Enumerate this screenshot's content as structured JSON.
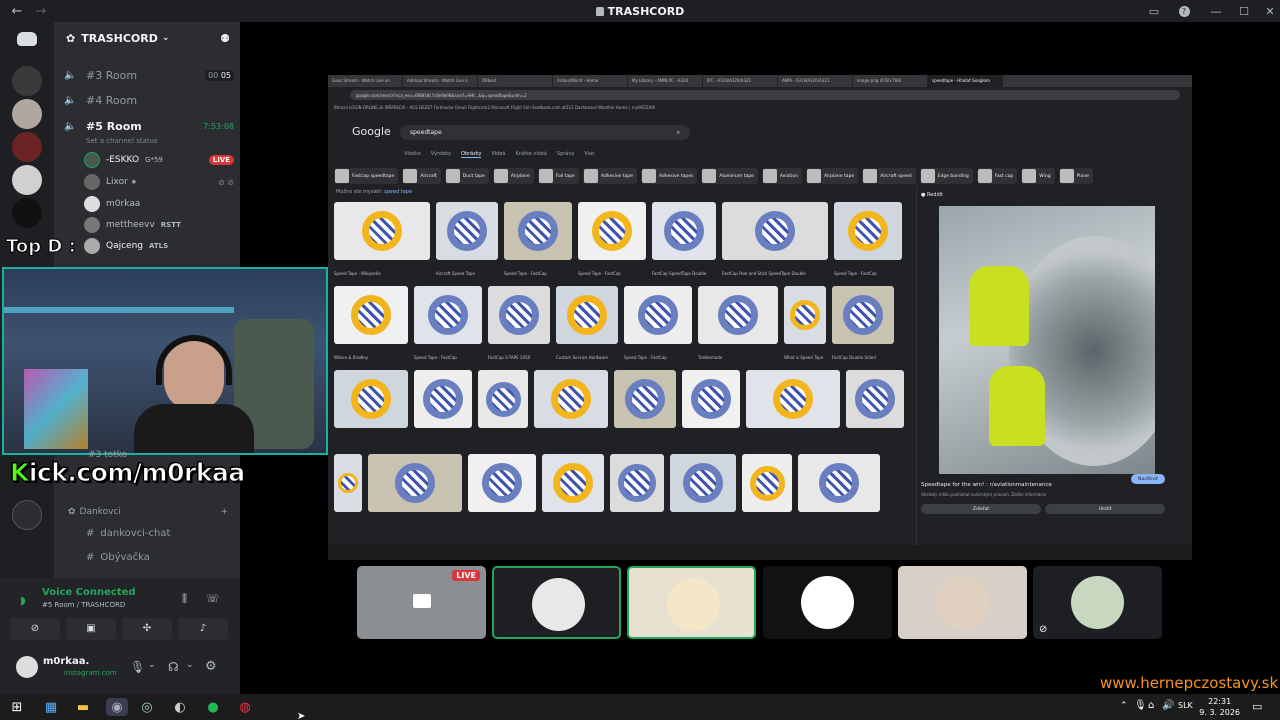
{
  "window": {
    "title": "TRASHCORD"
  },
  "server": {
    "name": "TRASHCORD",
    "voice_channels": [
      {
        "name": "#3 Room",
        "counter_a": "00",
        "counter_b": "05",
        "active": false
      },
      {
        "name": "#4 Room",
        "active": false
      },
      {
        "name": "#5 Room",
        "timer": "7:53:08",
        "active": true,
        "status": "Set a channel status"
      }
    ],
    "members": [
      {
        "name": "-ESKKO",
        "tag": "G*59",
        "live": "LIVE"
      },
      {
        "name": "Lixor",
        "tag": "★"
      },
      {
        "name": "m0rkaa"
      },
      {
        "name": "mettheevv",
        "tag": "RSTT"
      },
      {
        "name": "Qajceng",
        "tag": "ATLS"
      }
    ],
    "category": "Dankovci",
    "text_channels": [
      "dankovci-chat",
      "Obývačka"
    ]
  },
  "voice": {
    "status": "Voice Connected",
    "location": "#5 Room / TRASHCORD"
  },
  "user": {
    "name": "m0rkaa.",
    "subtitle": "instagram.com"
  },
  "overlay": {
    "kick_prefix": "K",
    "kick_rest": "ick.com/m0rkaa",
    "top_label": "Top D :",
    "hidden_channel_fragment": "#3 totko"
  },
  "stream": {
    "browser_tabs": [
      "Gaas Stream - Watch Live on",
      "m0rkaa Stream - Watch Live o",
      "OKbest",
      "Airbus/World - Home",
      "My Library - AMNLPC - A320",
      "IPC - A319/A320/A321",
      "AMM - A319/A320/A321",
      "image.png (678×768)",
      "speedtape - Hľadať Googlom"
    ],
    "url": "google.com/search?sca_esv=6f8818c7c8e9b98&sxsrf=AHt...&q=speedtape&udm=2",
    "bookmarks": "Bhmail  LOGIN ORLINE.sk  INŠPEKCIA - AGS  DEZET  Forkhome  Gmail  Flightcom2  Microsoft Flight Sim  Seatbook.com  atZ11 Dashboard  Weather  Home | myWIZZAIR",
    "search_query": "speedtape",
    "google_tabs": [
      "Všetko",
      "Výrobky",
      "Obrázky",
      "Videá",
      "Krátke videá",
      "Správy",
      "Viac"
    ],
    "active_google_tab": "Obrázky",
    "chips": [
      "Fastcap speedtape",
      "Aircraft",
      "Duct tape",
      "Airplane",
      "Foil tape",
      "Adhesive tape",
      "Adhesive tapes",
      "Aluminum tape",
      "Aviation",
      "Airplane tape",
      "Aircraft speed",
      "Edge banding",
      "Fast cap",
      "Wing",
      "Plane"
    ],
    "related_prefix": "Možno ste mysleli:",
    "related_term": "speed tape",
    "captions": [
      "Speed Tape - Wikipedia",
      "Aircraft Speed Tape",
      "Speed Tape - FastCap",
      "Speed Tape - FastCap",
      "FastCap SpeedTape Double",
      "FastCap Peel and Stick SpeedTape Double",
      "Speed Tape - FastCap",
      "Wilson & Bradley",
      "Speed Tape - FastCap",
      "FastCap S-TAPE 1X50",
      "Custom Service Hardware",
      "Speed Tape - FastCap",
      "Tradesmade",
      "What is Speed Tape",
      "FastCap Double Sided"
    ],
    "preview_source": "Reddit",
    "preview_title": "Speedtape for the win! : r/aviationmaintenance",
    "preview_sub": "Obrázky môžu podliehať autorským právam. Ďalšie informácie",
    "preview_btn_share": "Zdieľať",
    "preview_btn_save": "Uložiť",
    "preview_visit": "Navštíviť"
  },
  "tiles": [
    {
      "name": "stream-tile",
      "live": "LIVE"
    },
    {
      "name": "participant-2"
    },
    {
      "name": "participant-3"
    },
    {
      "name": "participant-4"
    },
    {
      "name": "participant-5"
    },
    {
      "name": "participant-6"
    }
  ],
  "taskbar": {
    "lang": "SLK",
    "time": "22:31",
    "date": "9. 3. 2026"
  },
  "watermark": "www.hernepczostavy.sk",
  "colors": {
    "accent_green": "#23a55a",
    "live_red": "#da373c",
    "kick_green": "#53fc18",
    "watermark_orange": "#f7931e"
  }
}
